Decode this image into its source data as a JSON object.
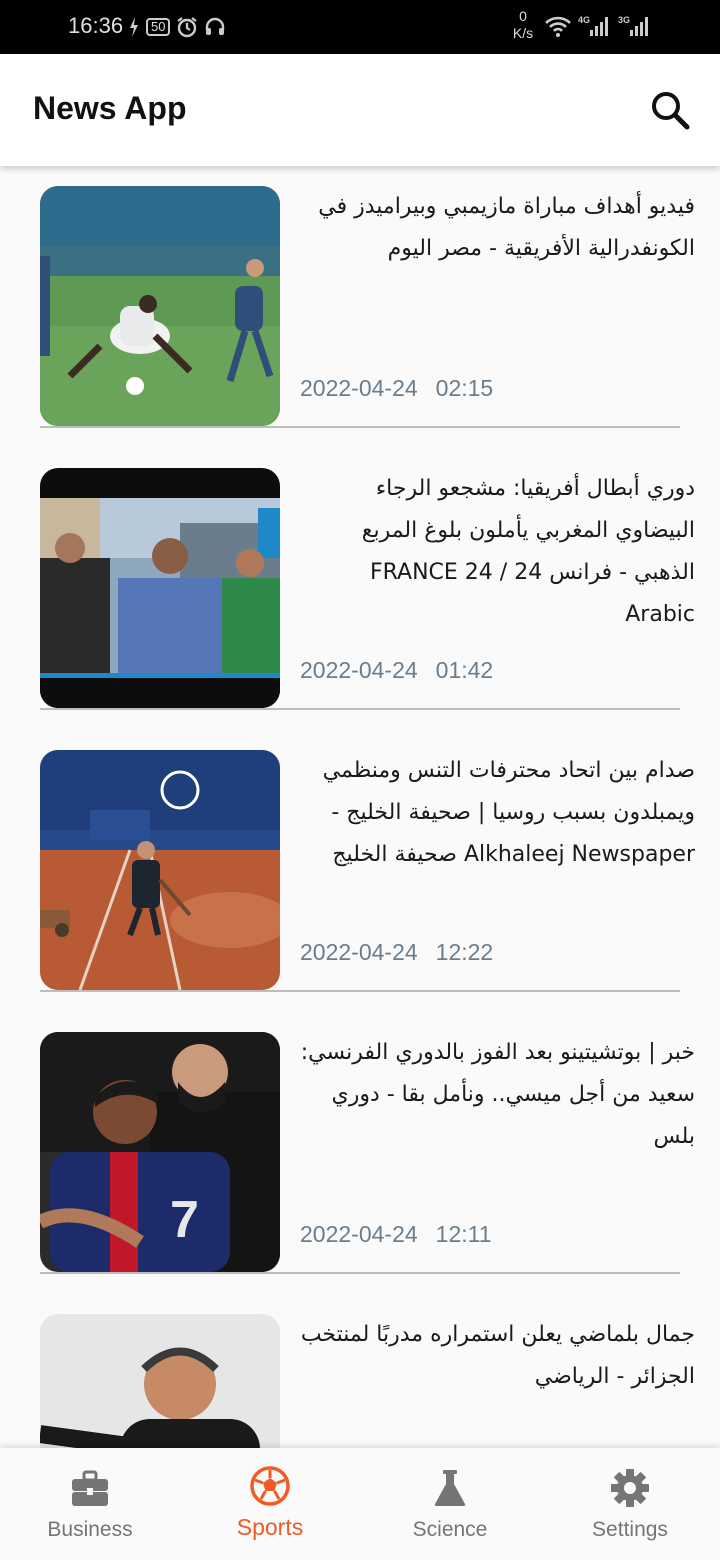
{
  "status_bar": {
    "time": "16:36",
    "battery": "50",
    "net_speed_value": "0",
    "net_speed_unit": "K/s"
  },
  "app_bar": {
    "title": "News App",
    "search_icon": "search-icon"
  },
  "articles": [
    {
      "headline": "فيديو أهداف مباراة مازيمبي وبيراميدز في الكونفدرالية الأفريقية - مصر اليوم",
      "date": "2022-04-24",
      "time": "02:15",
      "image": "soccer-match-photo"
    },
    {
      "headline": "دوري أبطال أفريقيا: مشجعو الرجاء البيضاوي المغربي يأملون بلوغ المربع الذهبي - فرانس 24 / FRANCE 24 Arabic",
      "date": "2022-04-24",
      "time": "01:42",
      "image": "tv-reporter-photo"
    },
    {
      "headline": "صدام بين اتحاد محترفات التنس ومنظمي ويمبلدون بسبب روسيا | صحيفة الخليج - Alkhaleej Newspaper  صحيفة الخليج",
      "date": "2022-04-24",
      "time": "12:22",
      "image": "clay-tennis-court-photo"
    },
    {
      "headline": "خبر | بوتشيتينو بعد الفوز بالدوري الفرنسي: سعيد من أجل ميسي.. ونأمل بقا - دوري بلس",
      "date": "2022-04-24",
      "time": "12:11",
      "image": "psg-players-photo"
    },
    {
      "headline": "جمال بلماضي يعلن استمراره مدربًا لمنتخب الجزائر - الرياضي",
      "date": "",
      "time": "",
      "image": "coach-photo"
    }
  ],
  "bottom_nav": [
    {
      "label": "Business",
      "icon": "briefcase-icon",
      "active": false
    },
    {
      "label": "Sports",
      "icon": "soccer-ball-icon",
      "active": true
    },
    {
      "label": "Science",
      "icon": "flask-icon",
      "active": false
    },
    {
      "label": "Settings",
      "icon": "gear-icon",
      "active": false
    }
  ],
  "colors": {
    "accent": "#f05a24",
    "meta_text": "#6a7d8c",
    "nav_inactive": "#757575"
  }
}
